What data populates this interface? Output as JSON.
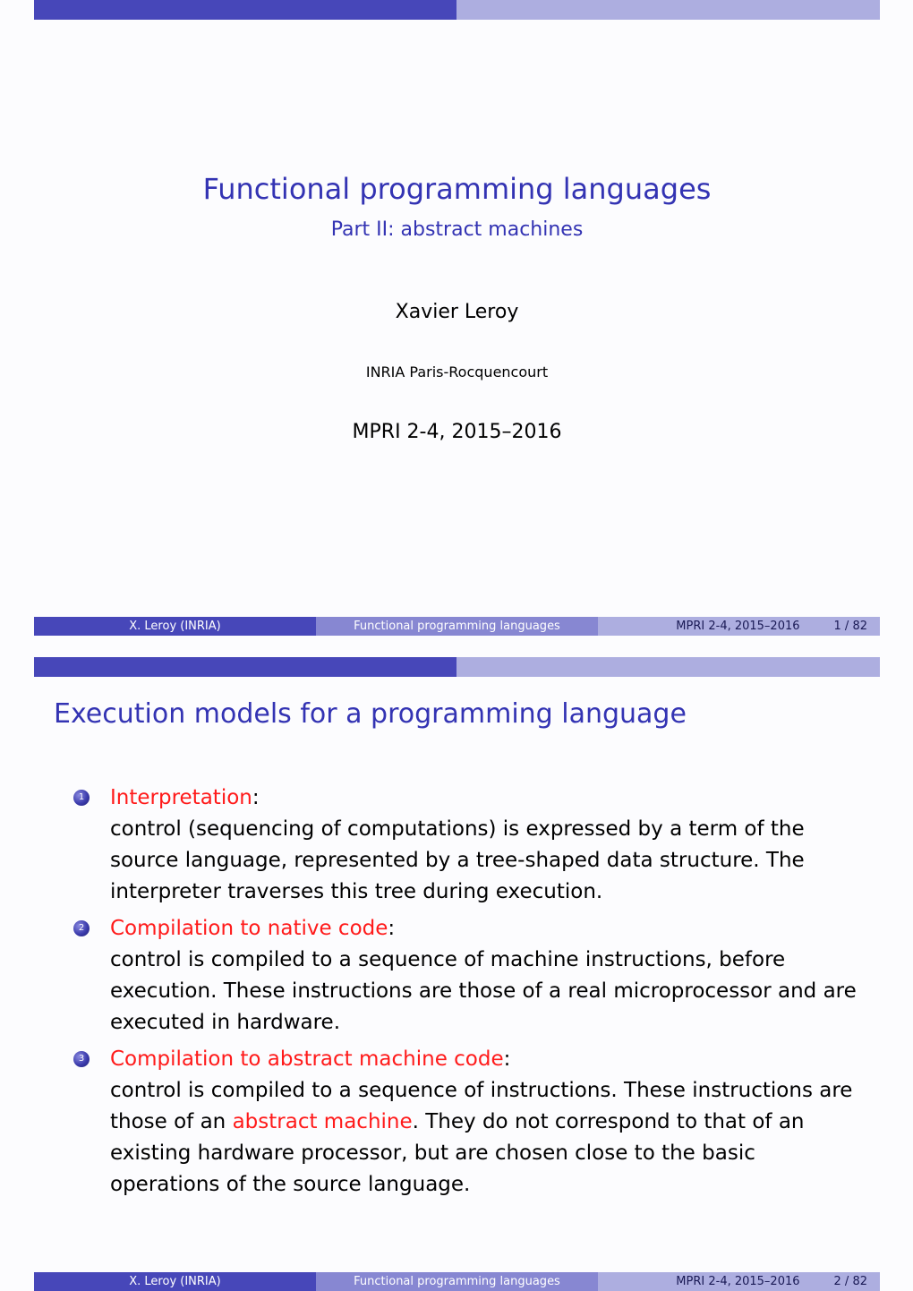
{
  "colors": {
    "structure_dark": "#4747b9",
    "structure_mid": "#8787d2",
    "structure_light": "#adaee0",
    "title": "#3333b3",
    "alert": "#ff1a1a"
  },
  "footer": {
    "author": "X. Leroy  (INRIA)",
    "title": "Functional programming languages",
    "date": "MPRI 2-4, 2015–2016"
  },
  "slide1": {
    "title": "Functional programming languages",
    "subtitle": "Part II: abstract machines",
    "author": "Xavier Leroy",
    "institute": "INRIA Paris-Rocquencourt",
    "date": "MPRI 2-4, 2015–2016",
    "page": "1 / 82"
  },
  "slide2": {
    "title": "Execution models for a programming language",
    "page": "2 / 82",
    "items": [
      {
        "number": "1",
        "heading": "Interpretation",
        "text": "control (sequencing of computations) is expressed by a term of the source language, represented by a tree-shaped data structure. The interpreter traverses this tree during execution."
      },
      {
        "number": "2",
        "heading": "Compilation to native code",
        "text": "control is compiled to a sequence of machine instructions, before execution. These instructions are those of a real microprocessor and are executed in hardware."
      },
      {
        "number": "3",
        "heading": "Compilation to abstract machine code",
        "text_before": "control is compiled to a sequence of instructions. These instructions are those of an ",
        "text_alert": "abstract machine",
        "text_after": ". They do not correspond to that of an existing hardware processor, but are chosen close to the basic operations of the source language."
      }
    ],
    "colon": ":"
  }
}
